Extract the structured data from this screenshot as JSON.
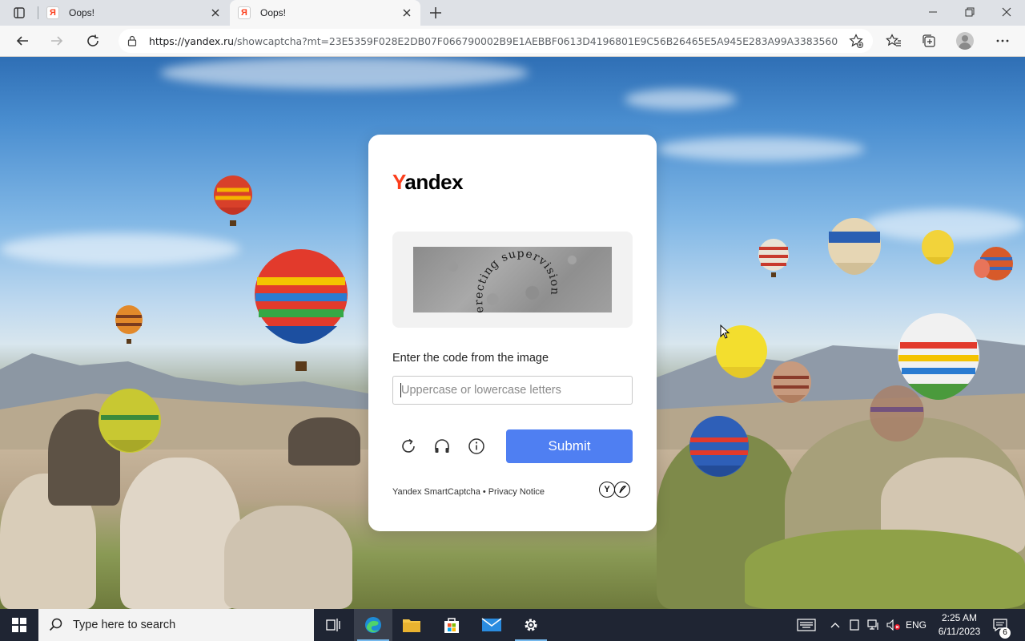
{
  "browser": {
    "tabs": [
      {
        "title": "Oops!",
        "favicon": "Я",
        "active": false
      },
      {
        "title": "Oops!",
        "favicon": "Я",
        "active": true
      }
    ],
    "url_host": "https://yandex.ru",
    "url_path": "/showcaptcha?mt=23E5359F028E2DB07F066790002B9E1AEBBF0613D4196801E9C56B26465E5A945E283A99A33835600..."
  },
  "captcha": {
    "logo_first": "Y",
    "logo_rest": "andex",
    "captcha_text": "erecting supervision",
    "prompt": "Enter the code from the image",
    "input_placeholder": "Uppercase or lowercase letters",
    "input_value": "",
    "submit_label": "Submit",
    "footer_brand": "Yandex SmartCaptcha",
    "footer_separator": "•",
    "footer_link": "Privacy Notice"
  },
  "taskbar": {
    "search_placeholder": "Type here to search",
    "language": "ENG",
    "time": "2:25 AM",
    "date": "6/11/2023",
    "notification_count": "6"
  },
  "colors": {
    "accent_button": "#4f7ff2",
    "yandex_red": "#fc3f1d",
    "taskbar": "#1f2533"
  }
}
